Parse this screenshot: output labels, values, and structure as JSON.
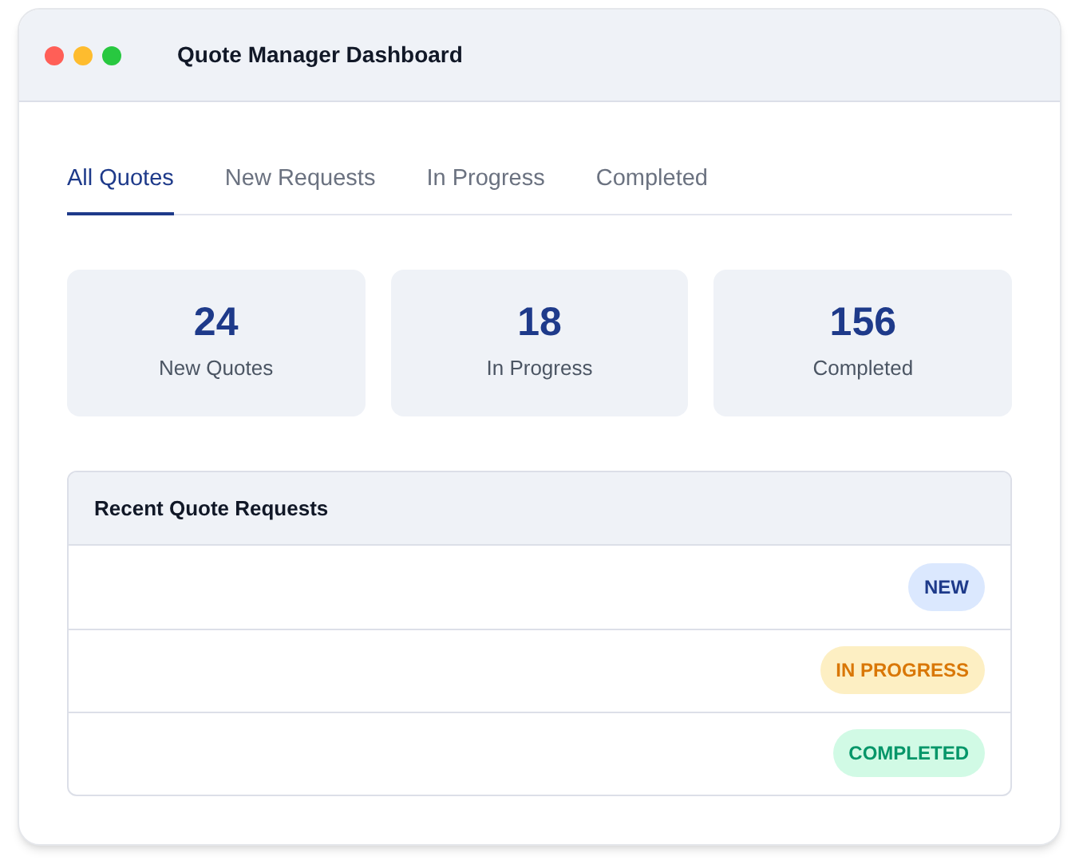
{
  "window": {
    "title": "Quote Manager Dashboard"
  },
  "tabs": [
    {
      "label": "All Quotes",
      "selected": true
    },
    {
      "label": "New Requests",
      "selected": false
    },
    {
      "label": "In Progress",
      "selected": false
    },
    {
      "label": "Completed",
      "selected": false
    }
  ],
  "stats": [
    {
      "value": "24",
      "label": "New Quotes"
    },
    {
      "value": "18",
      "label": "In Progress"
    },
    {
      "value": "156",
      "label": "Completed"
    }
  ],
  "table": {
    "title": "Recent Quote Requests",
    "rows": [
      {
        "status": "NEW",
        "kind": "new"
      },
      {
        "status": "IN PROGRESS",
        "kind": "in_progress"
      },
      {
        "status": "COMPLETED",
        "kind": "completed"
      }
    ]
  }
}
